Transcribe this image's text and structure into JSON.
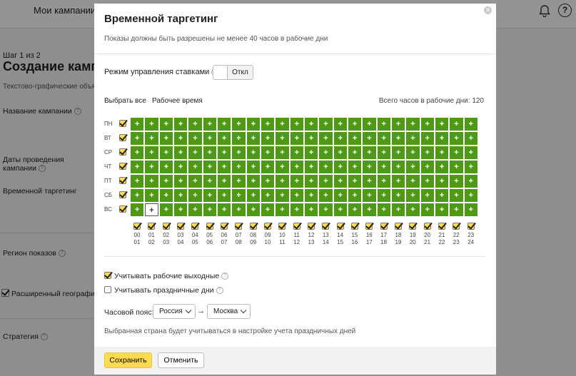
{
  "background": {
    "nav_campaigns": "Мои кампании",
    "step": "Шаг 1 из 2",
    "title": "Создание кампа",
    "subtitle": "Текстово-графические объя",
    "fields": {
      "name": "Название кампании",
      "dates_line1": "Даты проведения",
      "dates_line2": "кампании",
      "targeting": "Временной таргетинг",
      "region": "Регион показов",
      "extended_geo": "Расширенный географи",
      "strategy": "Стратегия"
    }
  },
  "modal": {
    "title": "Временной таргетинг",
    "description": "Показы должны быть разрешены не менее 40 часов в рабочие дни",
    "bid_mode_label": "Режим управления ставками",
    "bid_mode_state": "Откл",
    "select_all": "Выбрать все",
    "work_time": "Рабочее время",
    "total_hours": "Всего часов в рабочие дни: 120",
    "days": [
      "ПН",
      "ВТ",
      "СР",
      "ЧТ",
      "ПТ",
      "СБ",
      "ВС"
    ],
    "hours_start": [
      "00",
      "01",
      "02",
      "03",
      "04",
      "05",
      "06",
      "07",
      "08",
      "09",
      "10",
      "11",
      "12",
      "13",
      "14",
      "15",
      "16",
      "17",
      "18",
      "19",
      "20",
      "21",
      "22",
      "23"
    ],
    "hours_end": [
      "01",
      "02",
      "03",
      "04",
      "05",
      "06",
      "07",
      "08",
      "09",
      "10",
      "11",
      "12",
      "13",
      "14",
      "15",
      "16",
      "17",
      "18",
      "19",
      "20",
      "21",
      "22",
      "23",
      "24"
    ],
    "cell_symbol": "+",
    "highlight_cell": {
      "day": 6,
      "hour": 1
    },
    "cell_color": "#4e9a16",
    "check_color": "#ffdb4d",
    "option_workdays_off": "Учитывать рабочие выходные",
    "option_workdays_off_checked": true,
    "option_holidays": "Учитывать праздничные дни",
    "option_holidays_checked": false,
    "timezone_label": "Часовой пояс:",
    "timezone_country": "Россия",
    "timezone_arrow": "→",
    "timezone_city": "Москва",
    "note": "Выбранная страна будет учитываться в настройке учета праздничных дней",
    "save": "Сохранить",
    "cancel": "Отменить"
  }
}
